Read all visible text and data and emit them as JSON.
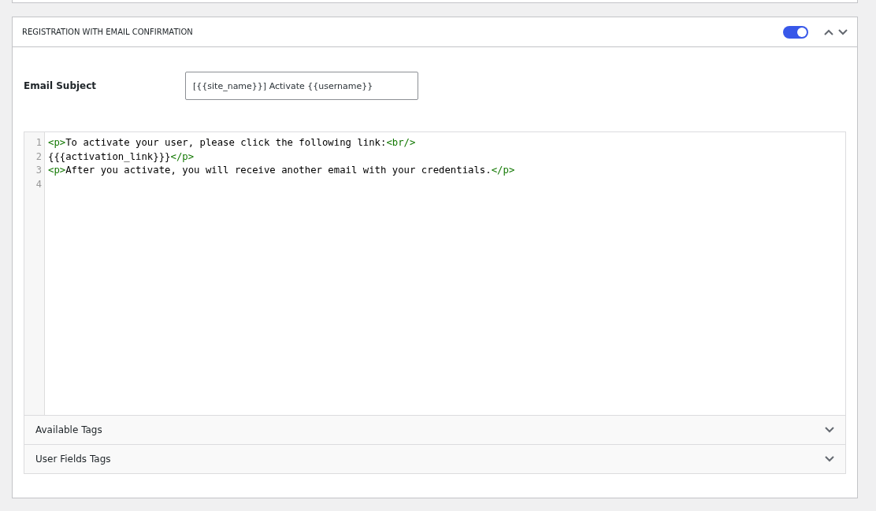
{
  "panel": {
    "title": "REGISTRATION WITH EMAIL CONFIRMATION",
    "enabled": true
  },
  "email_subject": {
    "label": "Email Subject",
    "value": "[{{site_name}}] Activate {{username}}"
  },
  "editor": {
    "lines": [
      {
        "number": "1",
        "tokens": [
          {
            "kind": "tag",
            "text": "<p>"
          },
          {
            "kind": "text",
            "text": "To activate your user, please click the following link:"
          },
          {
            "kind": "tag",
            "text": "<br/>"
          }
        ]
      },
      {
        "number": "2",
        "tokens": [
          {
            "kind": "text",
            "text": "{{{activation_link}}}"
          },
          {
            "kind": "tag",
            "text": "</p>"
          }
        ]
      },
      {
        "number": "3",
        "tokens": [
          {
            "kind": "tag",
            "text": "<p>"
          },
          {
            "kind": "text",
            "text": "After you activate, you will receive another email with your credentials."
          },
          {
            "kind": "tag",
            "text": "</p>"
          }
        ]
      },
      {
        "number": "4"
      }
    ]
  },
  "sections": [
    {
      "label": "Available Tags",
      "expanded": false
    },
    {
      "label": "User Fields Tags",
      "expanded": false
    }
  ]
}
